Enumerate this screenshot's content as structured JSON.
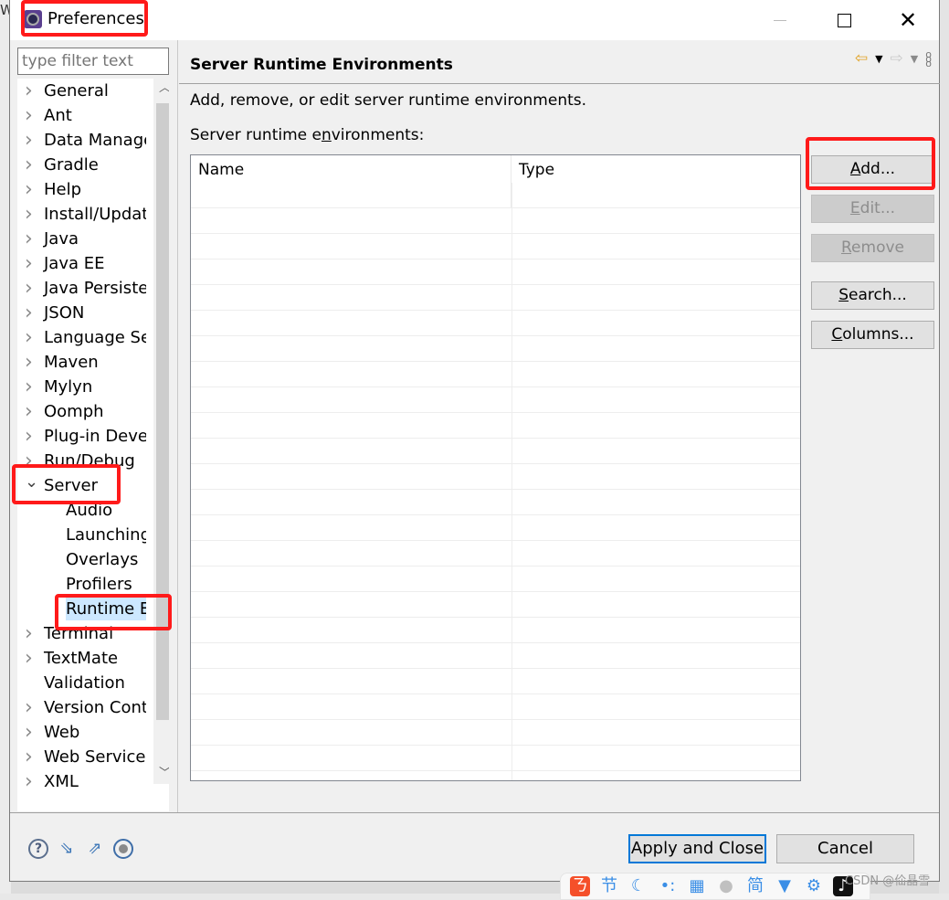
{
  "window": {
    "title": "Preferences",
    "background_letter": "W"
  },
  "sidebar": {
    "filter_placeholder": "type filter text",
    "items": [
      {
        "label": "General",
        "expander": "collapsed",
        "level": 0
      },
      {
        "label": "Ant",
        "expander": "collapsed",
        "level": 0
      },
      {
        "label": "Data Manage",
        "expander": "collapsed",
        "level": 0
      },
      {
        "label": "Gradle",
        "expander": "collapsed",
        "level": 0
      },
      {
        "label": "Help",
        "expander": "collapsed",
        "level": 0
      },
      {
        "label": "Install/Updat",
        "expander": "collapsed",
        "level": 0
      },
      {
        "label": "Java",
        "expander": "collapsed",
        "level": 0
      },
      {
        "label": "Java EE",
        "expander": "collapsed",
        "level": 0
      },
      {
        "label": "Java Persister",
        "expander": "collapsed",
        "level": 0
      },
      {
        "label": "JSON",
        "expander": "collapsed",
        "level": 0
      },
      {
        "label": "Language Se",
        "expander": "collapsed",
        "level": 0
      },
      {
        "label": "Maven",
        "expander": "collapsed",
        "level": 0
      },
      {
        "label": "Mylyn",
        "expander": "collapsed",
        "level": 0
      },
      {
        "label": "Oomph",
        "expander": "collapsed",
        "level": 0
      },
      {
        "label": "Plug-in Deve",
        "expander": "collapsed",
        "level": 0
      },
      {
        "label": "Run/Debug",
        "expander": "collapsed",
        "level": 0
      },
      {
        "label": "Server",
        "expander": "expanded",
        "level": 0
      },
      {
        "label": "Audio",
        "expander": "none",
        "level": 1
      },
      {
        "label": "Launching",
        "expander": "none",
        "level": 1
      },
      {
        "label": "Overlays",
        "expander": "none",
        "level": 1
      },
      {
        "label": "Profilers",
        "expander": "none",
        "level": 1
      },
      {
        "label": "Runtime E",
        "expander": "none",
        "level": 1,
        "selected": true
      },
      {
        "label": "Terminal",
        "expander": "collapsed",
        "level": 0
      },
      {
        "label": "TextMate",
        "expander": "collapsed",
        "level": 0
      },
      {
        "label": "Validation",
        "expander": "none",
        "level": 0
      },
      {
        "label": "Version Cont",
        "expander": "collapsed",
        "level": 0
      },
      {
        "label": "Web",
        "expander": "collapsed",
        "level": 0
      },
      {
        "label": "Web Services",
        "expander": "collapsed",
        "level": 0
      },
      {
        "label": "XML",
        "expander": "collapsed",
        "level": 0
      }
    ]
  },
  "page": {
    "title": "Server Runtime Environments",
    "description": "Add, remove, or edit server runtime environments.",
    "table_label_pre": "Server runtime e",
    "table_label_mnemonic": "n",
    "table_label_post": "vironments:",
    "table": {
      "columns": [
        "Name",
        "Type"
      ],
      "rows": []
    },
    "buttons": [
      {
        "mnemonic": "A",
        "rest": "dd...",
        "enabled": true
      },
      {
        "mnemonic": "E",
        "rest": "dit...",
        "enabled": false
      },
      {
        "mnemonic": "R",
        "rest": "emove",
        "enabled": false
      },
      {
        "mnemonic": "S",
        "rest": "earch...",
        "enabled": true
      },
      {
        "mnemonic": "C",
        "rest": "olumns...",
        "enabled": true
      }
    ]
  },
  "footer": {
    "apply_close_label": "Apply and Close",
    "cancel_label": "Cancel"
  },
  "taskbar": {
    "watermark": "CSDN @佡晶雪",
    "icons": [
      "sogou-icon",
      "chinese-char-icon",
      "moon-icon",
      "dots-icon",
      "keyboard-icon",
      "user-icon",
      "simplified-icon",
      "shirt-icon",
      "settings-icon",
      "tiktok-icon"
    ]
  },
  "colors": {
    "annotation": "#ff1a1a",
    "selection": "#cce8ff",
    "default_button_border": "#0078d7"
  }
}
